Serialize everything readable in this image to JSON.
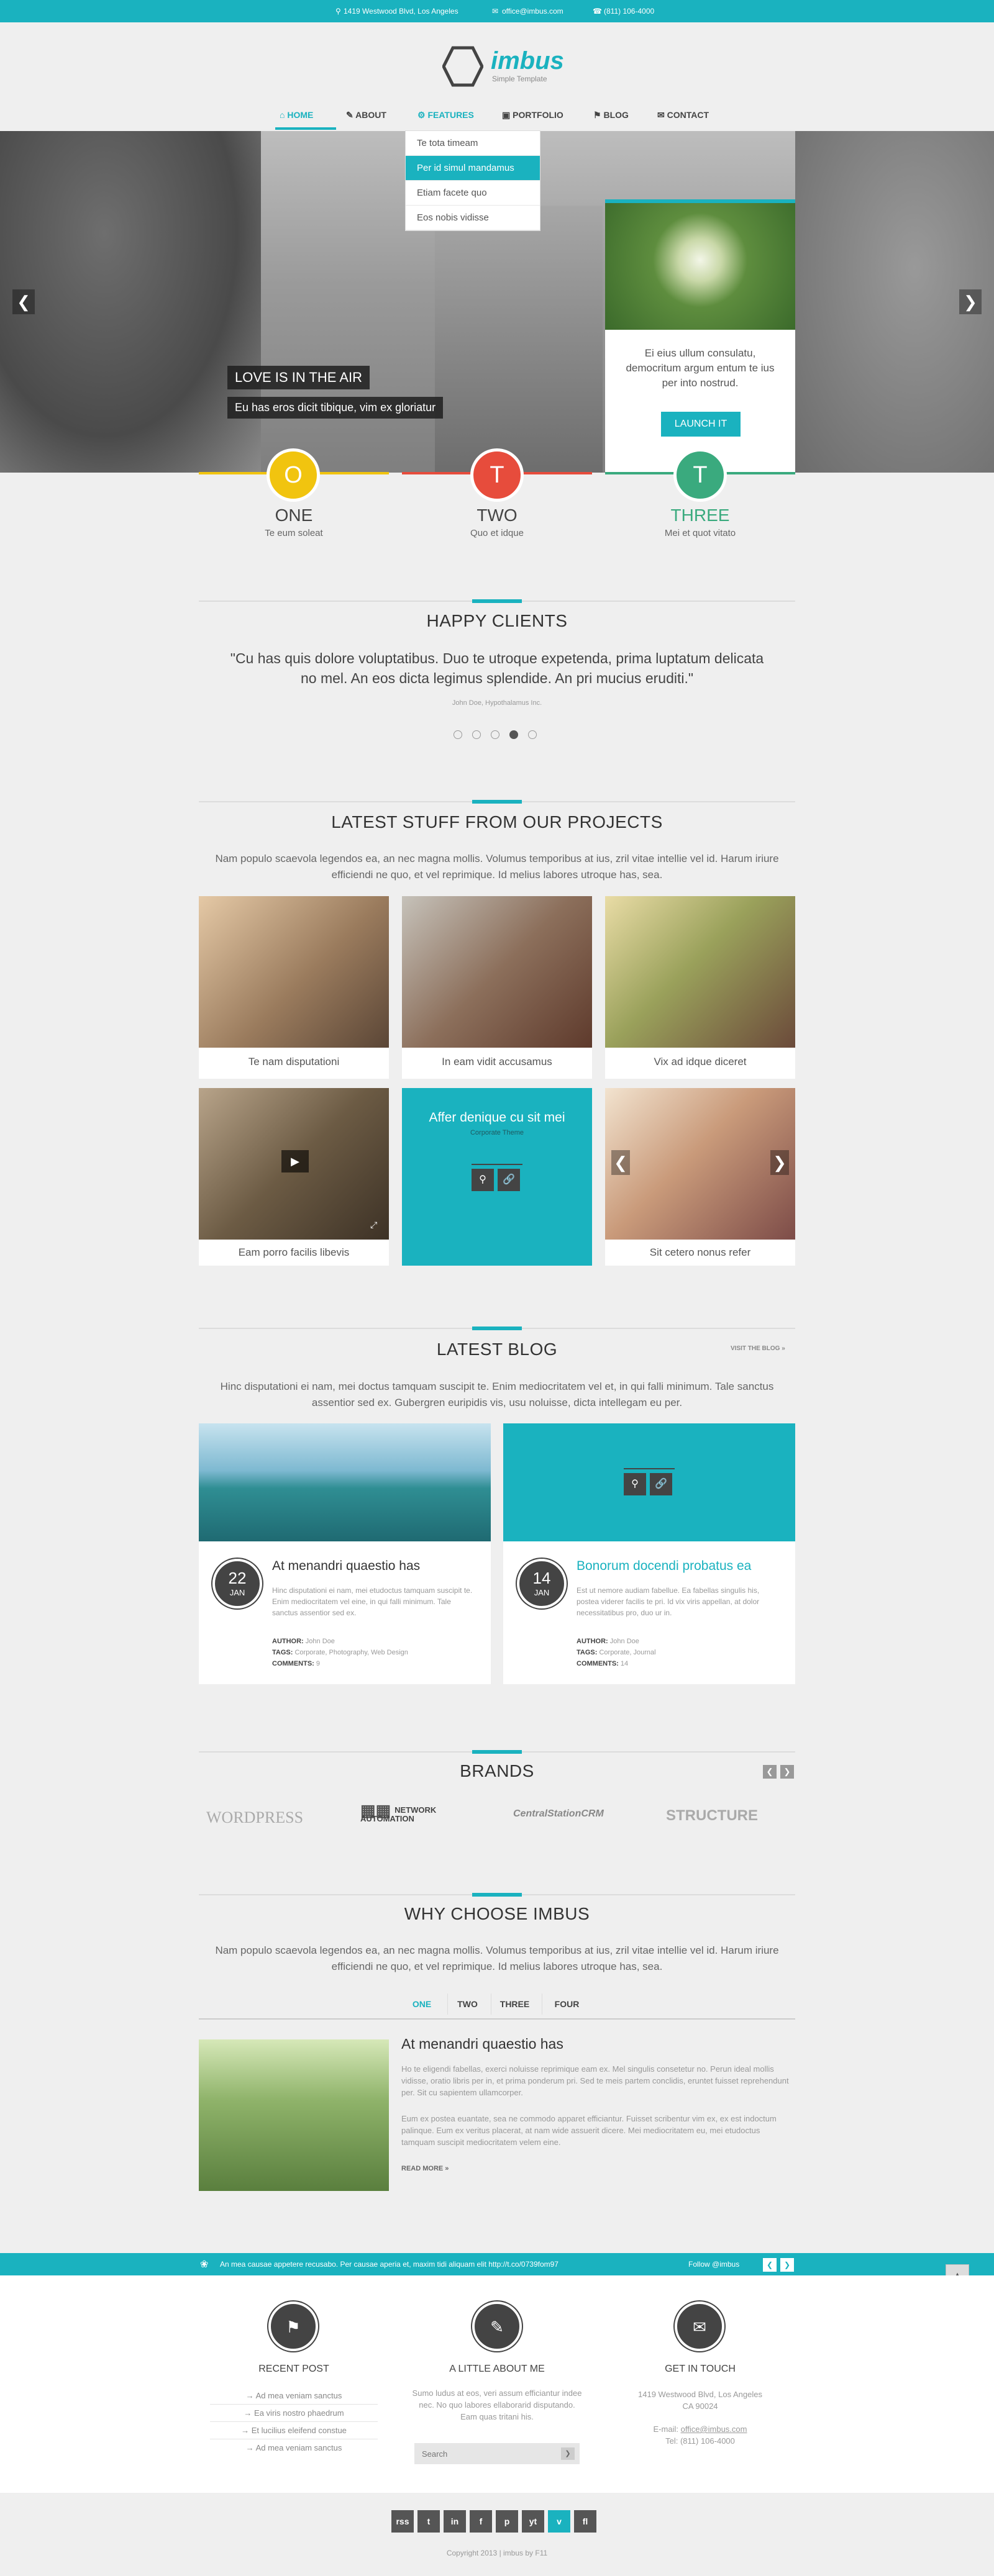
{
  "topbar": {
    "address": "1419 Westwood Blvd, Los Angeles",
    "email": "office@imbus.com",
    "phone": "(811) 106-4000"
  },
  "brand": {
    "name": "imbus",
    "tagline": "Simple Template"
  },
  "nav": [
    "HOME",
    "ABOUT",
    "FEATURES",
    "PORTFOLIO",
    "BLOG",
    "CONTACT"
  ],
  "dropdown": [
    "Te tota timeam",
    "Per id simul mandamus",
    "Etiam facete quo",
    "Eos nobis vidisse"
  ],
  "hero": {
    "title": "LOVE IS IN THE AIR",
    "subtitle": "Eu has eros dicit tibique, vim ex gloriatur",
    "side_text": "Ei eius ullum consulatu, democritum argum entum te ius per into nostrud.",
    "side_button": "LAUNCH IT"
  },
  "steps": [
    {
      "letter": "O",
      "title": "ONE",
      "sub": "Te eum soleat"
    },
    {
      "letter": "T",
      "title": "TWO",
      "sub": "Quo et idque"
    },
    {
      "letter": "T",
      "title": "THREE",
      "sub": "Mei et quot vitato"
    }
  ],
  "clients": {
    "title": "HAPPY CLIENTS",
    "quote": "\"Cu has quis dolore voluptatibus. Duo te utroque expetenda, prima luptatum delicata no mel. An eos dicta legimus splendide. An pri mucius eruditi.\"",
    "author": "John Doe, Hypothalamus Inc."
  },
  "projects": {
    "title": "LATEST STUFF FROM OUR PROJECTS",
    "intro": "Nam populo scaevola legendos ea, an nec magna mollis. Volumus temporibus at ius, zril vitae intellie vel id. Harum iriure efficiendi ne quo, et vel reprimique. Id melius labores utroque has, sea.",
    "items": [
      "Te nam disputationi",
      "In eam vidit accusamus",
      "Vix ad idque diceret",
      "Eam porro facilis libevis",
      "Affer denique cu sit mei",
      "Sit cetero nonus refer"
    ],
    "overlay_sub": "Corporate Theme"
  },
  "blog": {
    "title": "LATEST BLOG",
    "visit": "VISIT THE BLOG »",
    "intro": "Hinc disputationi ei nam, mei doctus tamquam suscipit te. Enim mediocritatem vel et, in qui falli minimum. Tale sanctus assentior sed ex. Gubergren euripidis vis, usu noluisse, dicta intellegam eu per.",
    "posts": [
      {
        "day": "22",
        "month": "JAN",
        "title": "At menandri quaestio has",
        "body": "Hinc disputationi ei nam, mei etudoctus tamquam suscipit te. Enim mediocritatem vel eine, in qui falli minimum. Tale sanctus assentior sed ex.",
        "author": "John Doe",
        "tags": "Corporate, Photography, Web Design",
        "comments": "9"
      },
      {
        "day": "14",
        "month": "JAN",
        "title": "Bonorum docendi probatus ea",
        "body": "Est ut nemore audiam fabellue. Ea fabellas singulis his, postea viderer facilis te pri. Id vix viris appellan, at dolor necessitatibus pro, duo ur in.",
        "author": "John Doe",
        "tags": "Corporate, Journal",
        "comments": "14"
      }
    ],
    "labels": {
      "author": "AUTHOR:",
      "tags": "TAGS:",
      "comments": "COMMENTS:"
    }
  },
  "brands": {
    "title": "BRANDS",
    "items": [
      "WORDPRESS",
      "NETWORK AUTOMATION",
      "CentralStationCRM",
      "STRUCTURE"
    ]
  },
  "why": {
    "title": "WHY CHOOSE IMBUS",
    "intro": "Nam populo scaevola legendos ea, an nec magna mollis. Volumus temporibus at ius, zril vitae intellie vel id. Harum iriure efficiendi ne quo, et vel reprimique. Id melius labores utroque has, sea.",
    "tabs": [
      "ONE",
      "TWO",
      "THREE",
      "FOUR"
    ],
    "heading": "At menandri quaestio has",
    "para1": "Ho te eligendi fabellas, exerci noluisse reprimique eam ex. Mel singulis consetetur no. Perun ideal mollis vidisse, oratio libris per in, et prima ponderum pri. Sed te meis partem conclidis, eruntet fuisset reprehendunt per. Sit cu sapientem ullamcorper.",
    "para2": "Eum ex postea euantate, sea ne commodo apparet efficiantur. Fuisset scribentur vim ex, ex est indoctum palinque. Eum ex veritus placerat, at nam wide assuerit dicere. Mei mediocritatem eu, mei etudoctus tamquam suscipit mediocritatem velem eine.",
    "more": "READ MORE »"
  },
  "twitter": {
    "text": "An mea causae appetere recusabo. Per causae aperia et, maxim tidi aliquam elit http://t.co/0739fom97",
    "follow": "Follow @imbus"
  },
  "footer": {
    "recent": {
      "title": "RECENT POST",
      "items": [
        "Ad mea veniam sanctus",
        "Ea viris nostro phaedrum",
        "Et lucilius eleifend constue",
        "Ad mea veniam sanctus"
      ]
    },
    "about": {
      "title": "A LITTLE ABOUT ME",
      "text": "Sumo ludus at eos, veri assum efficiantur indee nec. No quo labores ellaborarid disputando. Eam quas tritani his.",
      "search": "Search"
    },
    "touch": {
      "title": "GET IN TOUCH",
      "address1": "1419 Westwood Blvd, Los Angeles",
      "address2": "CA 90024",
      "email_label": "E-mail:",
      "email": "office@imbus.com",
      "tel": "Tel: (811) 106-4000"
    },
    "social": [
      "rss",
      "t",
      "in",
      "f",
      "p",
      "yt",
      "v",
      "fl"
    ],
    "copyright": "Copyright 2013 | imbus by F11"
  }
}
